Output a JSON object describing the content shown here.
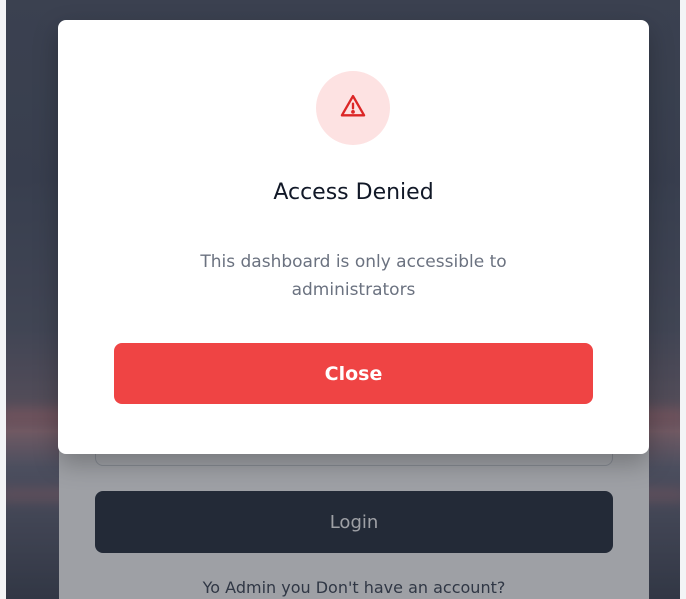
{
  "modal": {
    "icon": "warning-triangle-icon",
    "title": "Access Denied",
    "message": "This dashboard is only accessible to administrators",
    "close_label": "Close"
  },
  "login_form": {
    "login_label": "Login",
    "signup_prompt": "Yo Admin you Don't have an account?"
  },
  "colors": {
    "danger": "#ef4444",
    "danger_light": "#fde2e2",
    "dark_button": "#1f2937"
  }
}
